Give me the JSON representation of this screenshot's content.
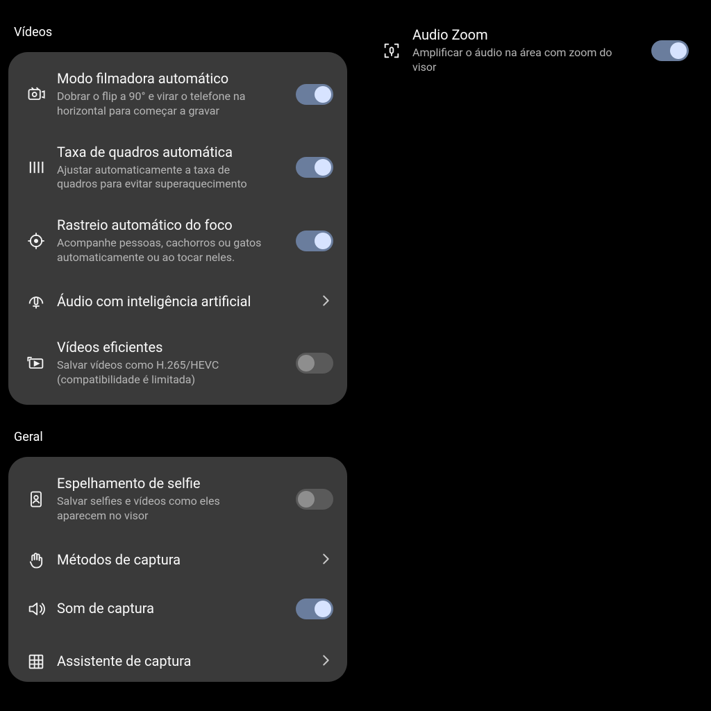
{
  "sections": {
    "videos": {
      "header": "Vídeos",
      "items": {
        "camcorder": {
          "title": "Modo filmadora automático",
          "desc": "Dobrar o flip a 90° e virar o telefone na horizontal para começar a gravar",
          "toggle_on": true
        },
        "framerate": {
          "title": "Taxa de quadros automática",
          "desc": "Ajustar automaticamente a taxa de quadros para evitar superaquecimento",
          "toggle_on": true
        },
        "focus": {
          "title": "Rastreio automático do foco",
          "desc": "Acompanhe pessoas, cachorros ou gatos automaticamente ou ao tocar neles.",
          "toggle_on": true
        },
        "ai_audio": {
          "title": "Áudio com inteligência artificial"
        },
        "efficient": {
          "title": "Vídeos eficientes",
          "desc": "Salvar vídeos como H.265/HEVC (compatibilidade é limitada)",
          "toggle_on": false
        }
      }
    },
    "general": {
      "header": "Geral",
      "items": {
        "mirror": {
          "title": "Espelhamento de selfie",
          "desc": "Salvar selfies e vídeos como eles aparecem no visor",
          "toggle_on": false
        },
        "capture_methods": {
          "title": "Métodos de captura"
        },
        "shutter_sound": {
          "title": "Som de captura",
          "toggle_on": true
        },
        "capture_assist": {
          "title": "Assistente de captura"
        }
      }
    },
    "right_panel": {
      "audio_zoom": {
        "title": "Audio Zoom",
        "desc": "Amplificar o áudio na área com zoom do visor",
        "toggle_on": true
      }
    }
  }
}
